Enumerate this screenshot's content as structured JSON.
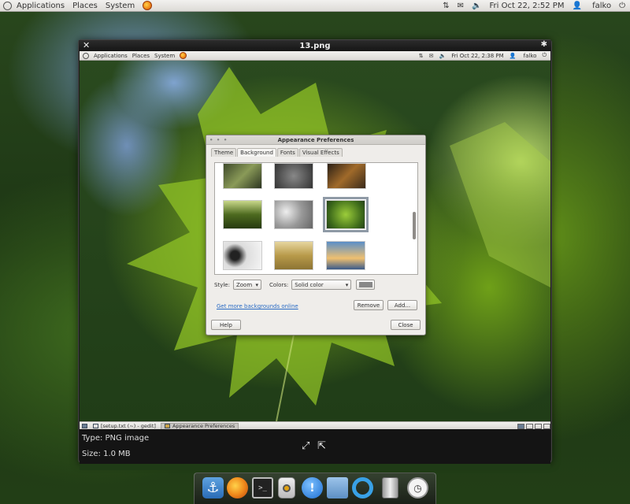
{
  "top_panel": {
    "menus": [
      "Applications",
      "Places",
      "System"
    ],
    "datetime": "Fri Oct 22,  2:52 PM",
    "user": "falko",
    "network_icon": "network-arrows-icon",
    "mail_icon": "mail-icon",
    "volume_icon": "volume-icon",
    "power_icon": "power-icon"
  },
  "viewer": {
    "title": "13.png",
    "info": {
      "type": "Type: PNG image",
      "size": "Size: 1.0 MB"
    }
  },
  "screenshot": {
    "panel": {
      "menus": [
        "Applications",
        "Places",
        "System"
      ],
      "datetime": "Fri Oct 22,  2:38 PM",
      "user": "falko"
    },
    "dialog": {
      "title": "Appearance Preferences",
      "tabs": [
        "Theme",
        "Background",
        "Fonts",
        "Visual Effects"
      ],
      "active_tab": "Background",
      "style_label": "Style:",
      "style_value": "Zoom",
      "colors_label": "Colors:",
      "colors_value": "Solid color",
      "swatch_color": "#888888",
      "link": "Get more backgrounds online",
      "remove": "Remove",
      "add": "Add...",
      "help": "Help",
      "close": "Close"
    },
    "taskbar": {
      "items": [
        "[setup.txt (~) - gedit]",
        "Appearance Preferences"
      ],
      "active_index": 1
    }
  },
  "dock": {
    "items": [
      "anchor-icon",
      "firefox-icon",
      "terminal-icon",
      "music-player-icon",
      "chat-icon",
      "folder-icon",
      "ring-icon",
      "trash-icon",
      "clock-icon"
    ]
  }
}
